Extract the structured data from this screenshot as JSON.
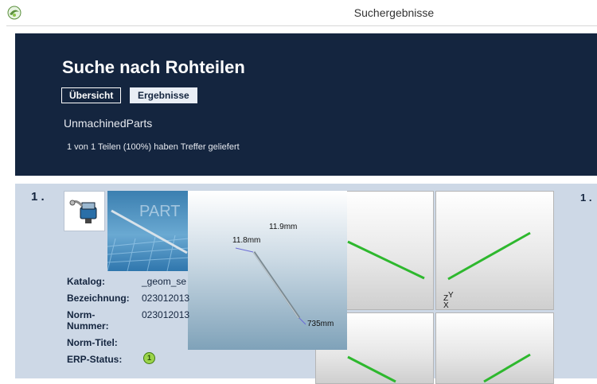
{
  "window": {
    "title": "Suchergebnisse",
    "icon": "app-logo-icon"
  },
  "header": {
    "title": "Suche nach Rohteilen",
    "tabs": [
      {
        "label": "Übersicht",
        "active": true
      },
      {
        "label": "Ergebnisse",
        "active": false
      }
    ],
    "subtitle": "UnmachinedParts",
    "info": "1 von 1 Teilen (100%) haben Treffer geliefert"
  },
  "result": {
    "number": "1 .",
    "number_right": "1 .",
    "thumbnail_text": "PART",
    "popup_dims": {
      "top": "11.9mm",
      "left": "11.8mm",
      "bottom": "735mm"
    },
    "axis_labels": {
      "z": "Z",
      "y": "Y",
      "x": "X"
    },
    "props": [
      {
        "label": "Katalog:",
        "value": "_geom_se"
      },
      {
        "label": "Bezeichnung:",
        "value": "023012013"
      },
      {
        "label": "Norm-Nummer:",
        "value": "023012013"
      },
      {
        "label": "Norm-Titel:",
        "value": ""
      },
      {
        "label": "ERP-Status:",
        "value": ""
      }
    ],
    "erp_badge": "1"
  },
  "colors": {
    "header_bg": "#14253f",
    "panel_bg": "#cdd8e6",
    "part_line": "#2eb82e",
    "erp_badge": "#9bd44a"
  }
}
